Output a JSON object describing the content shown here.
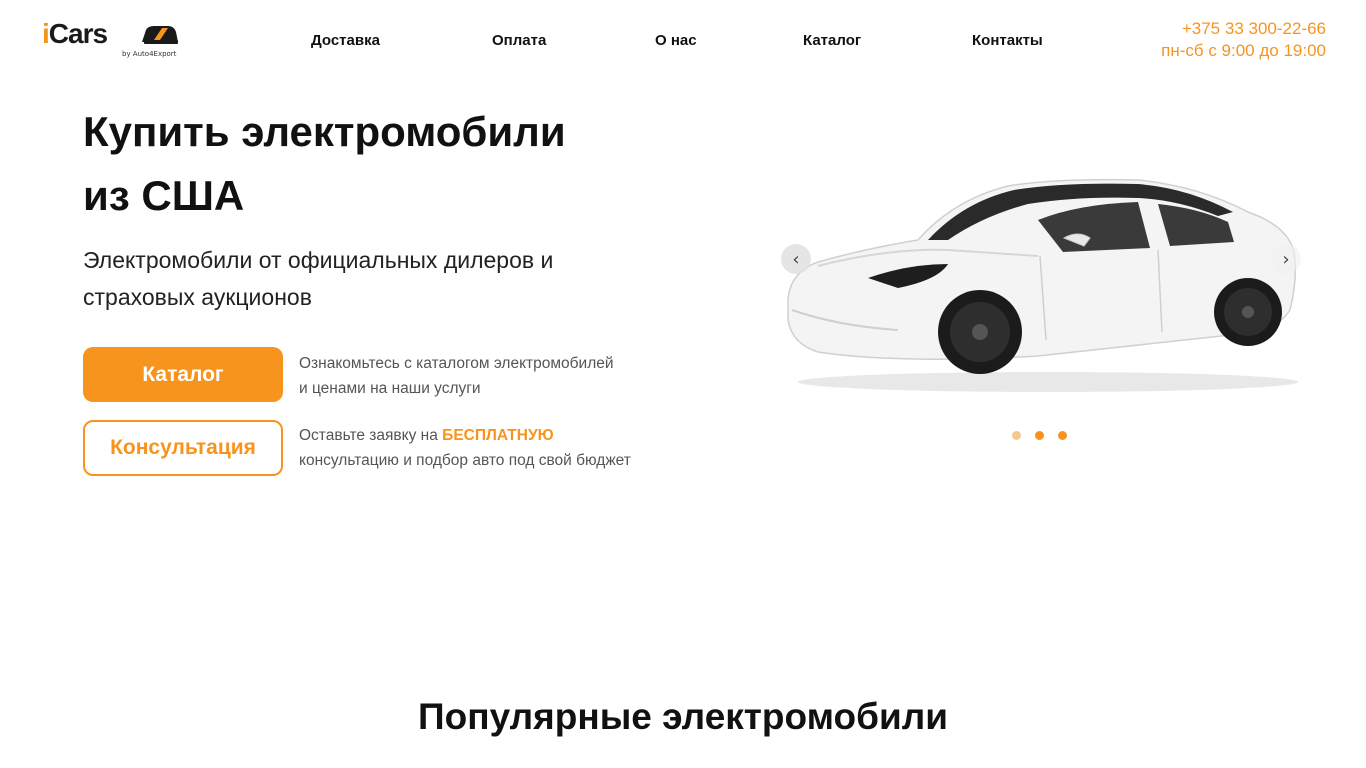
{
  "brand": {
    "logo_i": "i",
    "logo_cars": "Cars",
    "logo_sub": "by Auto4Export",
    "accent": "#f7941d"
  },
  "nav": {
    "delivery": "Доставка",
    "payment": "Оплата",
    "about": "О нас",
    "catalog": "Каталог",
    "contacts": "Контакты"
  },
  "contact": {
    "phone": "+375 33 300-22-66",
    "hours": "пн-сб с 9:00 до 19:00"
  },
  "hero": {
    "title_line1": "Купить электромобили",
    "title_line2": "из США",
    "subtitle": "Электромобили от официальных дилеров и страховых аукционов",
    "catalog_button": "Каталог",
    "catalog_desc_line1": "Ознакомьтесь с каталогом электромобилей",
    "catalog_desc_line2": "и ценами на наши услуги",
    "consult_button": "Консультация",
    "consult_desc_pre": "Оставьте заявку на",
    "consult_desc_highlight": "БЕСПЛАТНУЮ",
    "consult_desc_line2": "консультацию и подбор авто под свой бюджет"
  },
  "slider": {
    "image": "white-tesla-model-3",
    "prev_icon": "chevron-left-icon",
    "next_icon": "chevron-right-icon",
    "slide_count": 3
  },
  "section": {
    "popular_title": "Популярные электромобили"
  }
}
